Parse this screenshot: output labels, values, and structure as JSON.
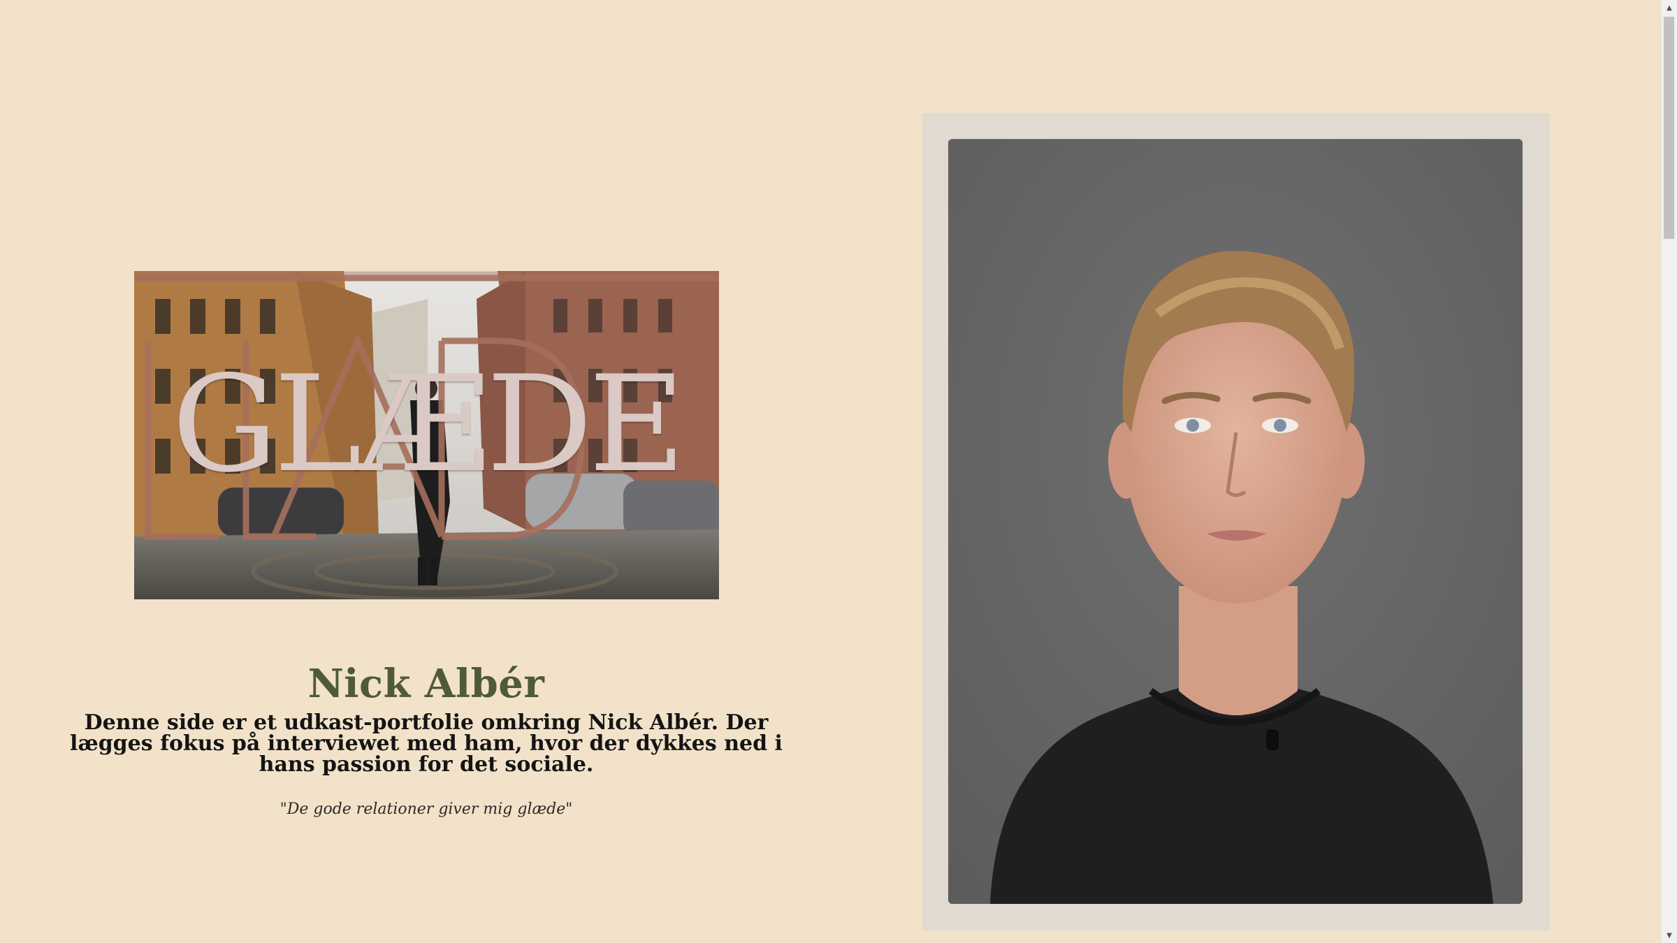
{
  "hero": {
    "overlay_text": "GLÆDE"
  },
  "profile": {
    "name": "Nick Albér",
    "intro": "Denne side er et udkast-portfolie omkring Nick Albér. Der lægges fokus på interviewet med ham, hvor der dykkes ned i hans passion for det sociale.",
    "quote": "\"De gode relationer giver mig glæde\""
  },
  "scrollbar": {
    "up_icon": "▲",
    "down_icon": "▼"
  },
  "colors": {
    "background": "#f2e2c9",
    "name_color": "#4f5a3a",
    "overlay_outline": "#a66f5c",
    "overlay_fill": "#d8c9c6",
    "frame": "#e1dad0"
  }
}
